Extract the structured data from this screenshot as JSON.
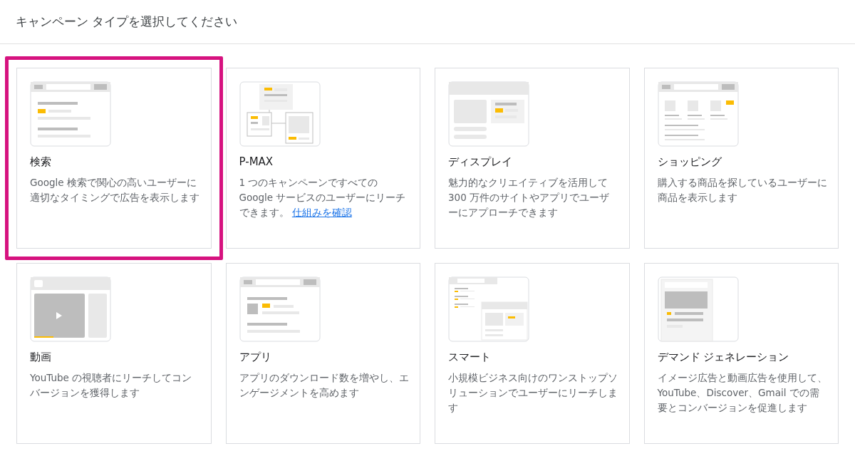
{
  "header": {
    "title": "キャンペーン タイプを選択してください"
  },
  "cards": [
    {
      "kind": "search",
      "title": "検索",
      "description": "Google 検索で関心の高いユーザーに適切なタイミングで広告を表示します",
      "selected": true
    },
    {
      "kind": "pmax",
      "title": "P-MAX",
      "description": "1 つのキャンペーンですべての Google サービスのユーザーにリーチできます。",
      "link": "仕組みを確認",
      "selected": false
    },
    {
      "kind": "display",
      "title": "ディスプレイ",
      "description": "魅力的なクリエイティブを活用して 300 万件のサイトやアプリでユーザーにアプローチできます",
      "selected": false
    },
    {
      "kind": "shopping",
      "title": "ショッピング",
      "description": "購入する商品を探しているユーザーに商品を表示します",
      "selected": false
    },
    {
      "kind": "video",
      "title": "動画",
      "description": "YouTube の視聴者にリーチしてコンバージョンを獲得します",
      "selected": false
    },
    {
      "kind": "app",
      "title": "アプリ",
      "description": "アプリのダウンロード数を増やし、エンゲージメントを高めます",
      "selected": false
    },
    {
      "kind": "smart",
      "title": "スマート",
      "description": "小規模ビジネス向けのワンストップソリューションでユーザーにリーチします",
      "selected": false
    },
    {
      "kind": "demand_gen",
      "title": "デマンド ジェネレーション",
      "description": "イメージ広告と動画広告を使用して、YouTube、Discover、Gmail での需要とコンバージョンを促進します",
      "selected": false
    }
  ]
}
